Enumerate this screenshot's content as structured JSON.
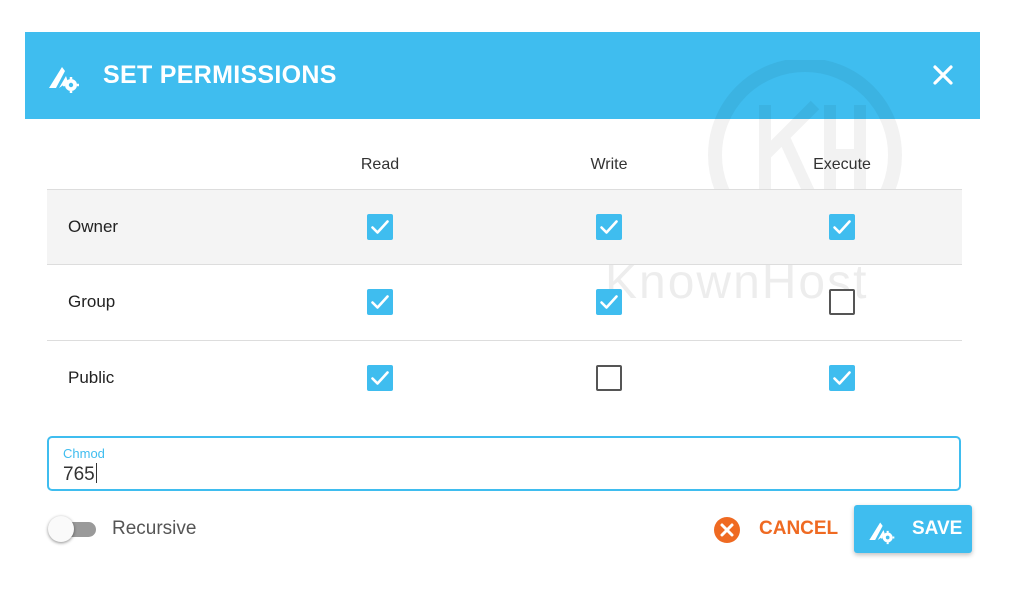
{
  "dialog": {
    "title": "SET PERMISSIONS",
    "header_icon": "wrench-gear-icon",
    "close_icon": "close-icon",
    "accent_color": "#3fbdef"
  },
  "table": {
    "columns": [
      "Read",
      "Write",
      "Execute"
    ],
    "rows": [
      {
        "label": "Owner",
        "read": true,
        "write": true,
        "execute": true
      },
      {
        "label": "Group",
        "read": true,
        "write": true,
        "execute": false
      },
      {
        "label": "Public",
        "read": true,
        "write": false,
        "execute": true
      }
    ]
  },
  "chmod": {
    "label": "Chmod",
    "value": "765"
  },
  "recursive": {
    "label": "Recursive",
    "enabled": false
  },
  "actions": {
    "cancel_label": "CANCEL",
    "cancel_icon": "close-circle-icon",
    "cancel_color": "#ef6a22",
    "save_label": "SAVE",
    "save_icon": "wrench-gear-icon"
  },
  "watermark": {
    "text": "KnownHost"
  }
}
